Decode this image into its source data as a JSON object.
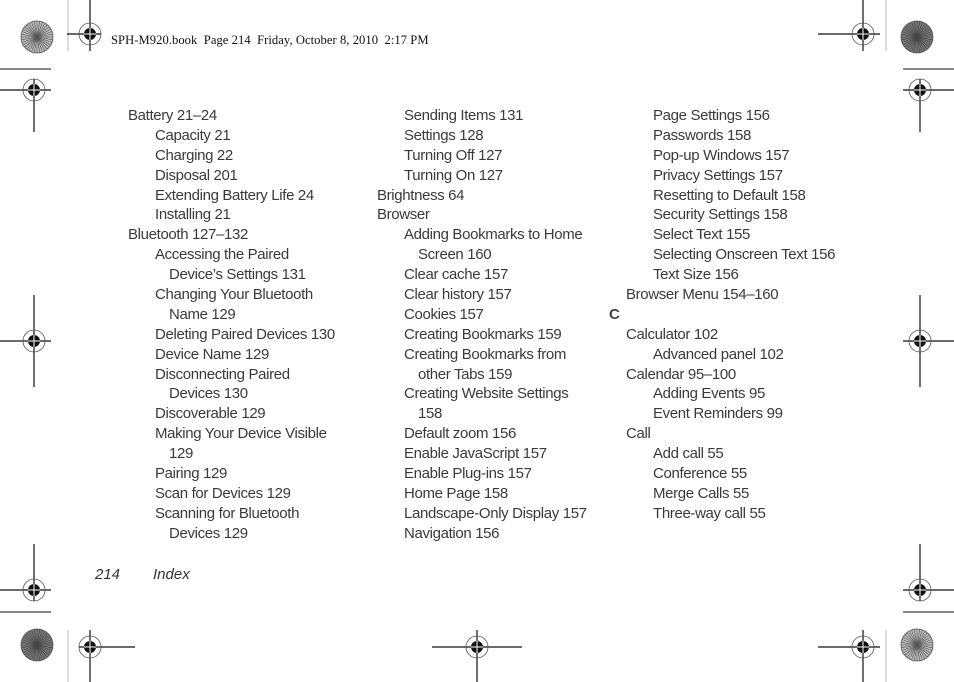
{
  "header": {
    "slug": "SPH-M920.book  Page 214  Friday, October 8, 2010  2:17 PM"
  },
  "columns": [
    {
      "entries": [
        {
          "level": 1,
          "text": "Battery 21–24"
        },
        {
          "level": 2,
          "text": "Capacity 21"
        },
        {
          "level": 2,
          "text": "Charging 22"
        },
        {
          "level": 2,
          "text": "Disposal 201"
        },
        {
          "level": 2,
          "text": "Extending Battery Life 24"
        },
        {
          "level": 2,
          "text": "Installing 21"
        },
        {
          "level": 1,
          "text": "Bluetooth 127–132"
        },
        {
          "level": 2,
          "text": "Accessing the Paired"
        },
        {
          "level": 3,
          "text": "Device’s Settings 131"
        },
        {
          "level": 2,
          "text": "Changing Your Bluetooth"
        },
        {
          "level": 3,
          "text": "Name 129"
        },
        {
          "level": 2,
          "text": "Deleting Paired Devices 130"
        },
        {
          "level": 2,
          "text": "Device Name 129"
        },
        {
          "level": 2,
          "text": "Disconnecting Paired"
        },
        {
          "level": 3,
          "text": "Devices 130"
        },
        {
          "level": 2,
          "text": "Discoverable 129"
        },
        {
          "level": 2,
          "text": "Making Your Device Visible"
        },
        {
          "level": 3,
          "text": "129"
        },
        {
          "level": 2,
          "text": "Pairing 129"
        },
        {
          "level": 2,
          "text": "Scan for Devices 129"
        },
        {
          "level": 2,
          "text": "Scanning for Bluetooth"
        },
        {
          "level": 3,
          "text": "Devices 129"
        }
      ]
    },
    {
      "entries": [
        {
          "level": 2,
          "text": "Sending Items 131"
        },
        {
          "level": 2,
          "text": "Settings 128"
        },
        {
          "level": 2,
          "text": "Turning Off 127"
        },
        {
          "level": 2,
          "text": "Turning On 127"
        },
        {
          "level": 1,
          "text": "Brightness 64"
        },
        {
          "level": 1,
          "text": "Browser"
        },
        {
          "level": 2,
          "text": "Adding Bookmarks to Home"
        },
        {
          "level": 3,
          "text": "Screen 160"
        },
        {
          "level": 2,
          "text": "Clear cache 157"
        },
        {
          "level": 2,
          "text": "Clear history 157"
        },
        {
          "level": 2,
          "text": "Cookies 157"
        },
        {
          "level": 2,
          "text": "Creating Bookmarks 159"
        },
        {
          "level": 2,
          "text": "Creating Bookmarks from"
        },
        {
          "level": 3,
          "text": "other Tabs 159"
        },
        {
          "level": 2,
          "text": "Creating Website Settings"
        },
        {
          "level": 3,
          "text": "158"
        },
        {
          "level": 2,
          "text": "Default zoom 156"
        },
        {
          "level": 2,
          "text": "Enable JavaScript 157"
        },
        {
          "level": 2,
          "text": "Enable Plug-ins 157"
        },
        {
          "level": 2,
          "text": "Home Page 158"
        },
        {
          "level": 2,
          "text": "Landscape-Only Display 157"
        },
        {
          "level": 2,
          "text": "Navigation 156"
        }
      ]
    },
    {
      "entries": [
        {
          "level": 2,
          "text": "Page Settings 156"
        },
        {
          "level": 2,
          "text": "Passwords 158"
        },
        {
          "level": 2,
          "text": "Pop-up Windows 157"
        },
        {
          "level": 2,
          "text": "Privacy Settings 157"
        },
        {
          "level": 2,
          "text": "Resetting to Default 158"
        },
        {
          "level": 2,
          "text": "Security Settings 158"
        },
        {
          "level": 2,
          "text": "Select Text 155"
        },
        {
          "level": 2,
          "text": "Selecting Onscreen Text 156"
        },
        {
          "level": 2,
          "text": "Text Size 156"
        },
        {
          "level": 1,
          "text": "Browser Menu 154–160"
        },
        {
          "level": 0,
          "text": "C"
        },
        {
          "level": 1,
          "text": "Calculator 102"
        },
        {
          "level": 2,
          "text": "Advanced panel 102"
        },
        {
          "level": 1,
          "text": "Calendar 95–100"
        },
        {
          "level": 2,
          "text": "Adding Events 95"
        },
        {
          "level": 2,
          "text": "Event Reminders 99"
        },
        {
          "level": 1,
          "text": "Call"
        },
        {
          "level": 2,
          "text": "Add call 55"
        },
        {
          "level": 2,
          "text": "Conference 55"
        },
        {
          "level": 2,
          "text": "Merge Calls 55"
        },
        {
          "level": 2,
          "text": "Three-way call 55"
        }
      ]
    }
  ],
  "footer": {
    "page_number": "214",
    "section": "Index"
  },
  "marks": {
    "registration": "registration-crosshair-icon",
    "color_bar": "color-wheel-icon",
    "ink": "#111111"
  }
}
